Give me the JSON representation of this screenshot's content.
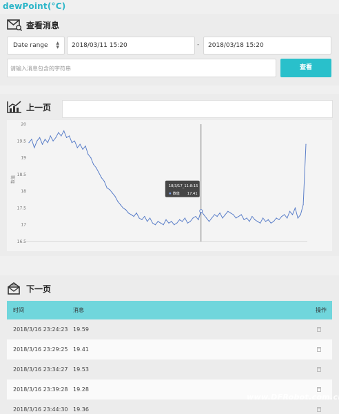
{
  "page_title": "dewPoint(°C)",
  "query": {
    "header": "查看消息",
    "range_select": "Date range",
    "start_date": "2018/03/11 15:20",
    "separator": "-",
    "end_date": "2018/03/18 15:20",
    "search_placeholder": "请输入消息包含的字符串",
    "search_button": "查看"
  },
  "chart_section": {
    "header": "上一页",
    "tooltip": {
      "time": "18/3/17_11:8:15",
      "label": "数值",
      "value": "17.41"
    }
  },
  "chart_data": {
    "type": "line",
    "title": "",
    "xlabel": "",
    "ylabel": "数值",
    "ylim": [
      16.5,
      20
    ],
    "yticks": [
      "20",
      "19.5",
      "19",
      "18.5",
      "18",
      "17.5",
      "17",
      "16.5"
    ],
    "grid": false,
    "series": [
      {
        "values": [
          19.45,
          19.55,
          19.3,
          19.5,
          19.6,
          19.4,
          19.55,
          19.45,
          19.65,
          19.5,
          19.6,
          19.75,
          19.65,
          19.8,
          19.6,
          19.65,
          19.45,
          19.5,
          19.3,
          19.4,
          19.25,
          19.35,
          19.1,
          19.0,
          18.8,
          18.7,
          18.55,
          18.4,
          18.3,
          18.1,
          18.05,
          17.95,
          17.85,
          17.7,
          17.6,
          17.5,
          17.45,
          17.35,
          17.3,
          17.25,
          17.35,
          17.2,
          17.15,
          17.25,
          17.1,
          17.2,
          17.05,
          17.0,
          17.1,
          17.05,
          17.0,
          17.15,
          17.05,
          17.1,
          17.0,
          17.05,
          17.15,
          17.1,
          17.2,
          17.05,
          17.1,
          17.2,
          17.25,
          17.15,
          17.41,
          17.3,
          17.2,
          17.1,
          17.2,
          17.3,
          17.25,
          17.35,
          17.2,
          17.3,
          17.4,
          17.35,
          17.3,
          17.2,
          17.25,
          17.3,
          17.15,
          17.2,
          17.1,
          17.25,
          17.15,
          17.1,
          17.05,
          17.2,
          17.1,
          17.15,
          17.05,
          17.1,
          17.2,
          17.15,
          17.25,
          17.3,
          17.2,
          17.4,
          17.3,
          17.5,
          17.2,
          17.3,
          17.6,
          19.4
        ]
      }
    ],
    "highlight_index": 64,
    "line_color": "#5b7fc9"
  },
  "table_section": {
    "header": "下一页",
    "columns": [
      "时间",
      "消息",
      "操作"
    ],
    "rows": [
      {
        "time": "2018/3/16 23:24:23",
        "value": "19.59"
      },
      {
        "time": "2018/3/16 23:29:25",
        "value": "19.41"
      },
      {
        "time": "2018/3/16 23:34:27",
        "value": "19.53"
      },
      {
        "time": "2018/3/16 23:39:28",
        "value": "19.28"
      },
      {
        "time": "2018/3/16 23:44:30",
        "value": "19.36"
      }
    ]
  },
  "watermark": "www.DFRobot.com.cn",
  "colors": {
    "accent": "#29c0cb",
    "table_header": "#70d6dc",
    "title": "#2bb5c8"
  }
}
